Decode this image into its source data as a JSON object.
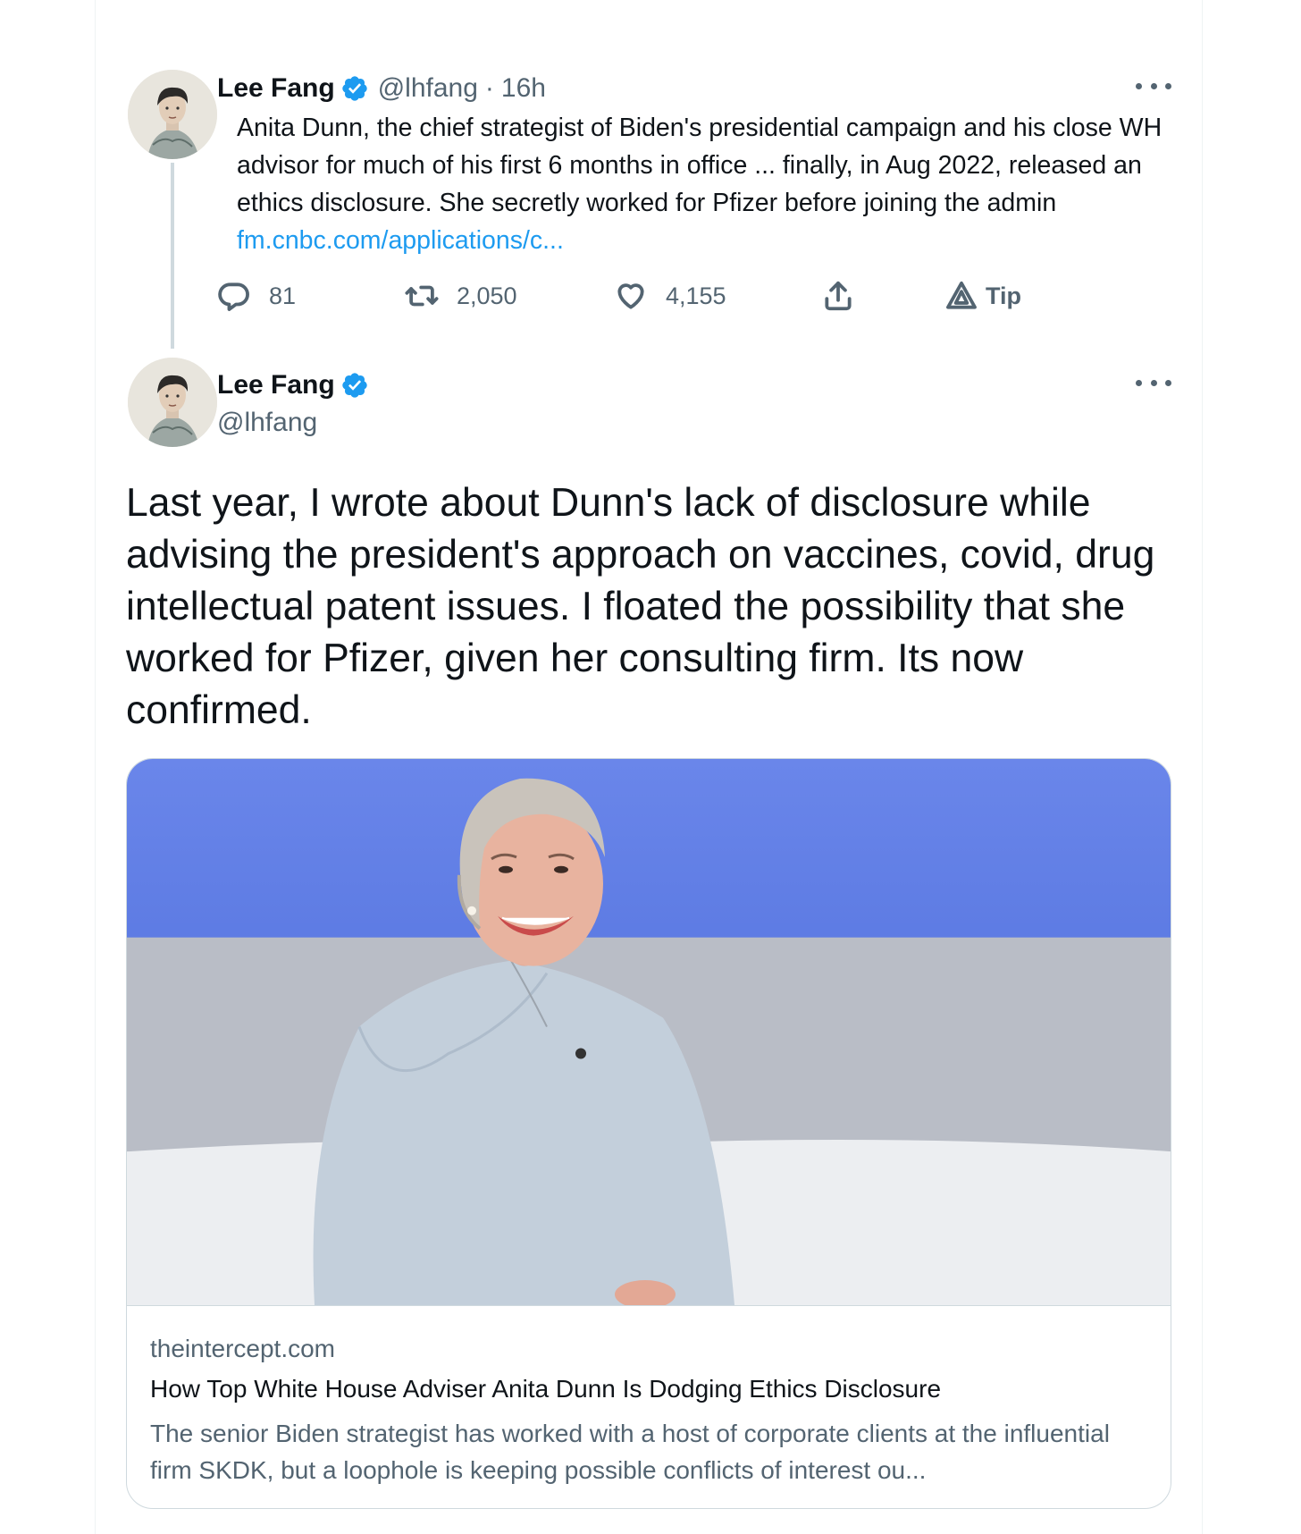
{
  "parent_tweet": {
    "author_name": "Lee Fang",
    "handle": "@lhfang",
    "separator": "·",
    "time": "16h",
    "text": "Anita Dunn, the chief strategist of Biden's presidential campaign and his close WH advisor for much of his first 6 months in office ... finally, in Aug 2022, released an ethics disclosure. She secretly worked for Pfizer before joining the admin ",
    "link_text": "fm.cnbc.com/applications/c...",
    "actions": {
      "replies": "81",
      "retweets": "2,050",
      "likes": "4,155",
      "tip_label": "Tip"
    }
  },
  "main_tweet": {
    "author_name": "Lee Fang",
    "handle": "@lhfang",
    "text": "Last year, I wrote about Dunn's lack of disclosure while advising the president's approach on vaccines, covid, drug intellectual patent issues. I floated the possibility that she worked for Pfizer, given her consulting firm. Its now confirmed.",
    "card": {
      "domain": "theintercept.com",
      "title": "How Top White House Adviser Anita Dunn Is Dodging Ethics Disclosure",
      "description": "The senior Biden strategist has worked with a host of corporate clients at the influential firm SKDK, but a loophole is keeping possible conflicts of interest ou..."
    }
  },
  "icons": [
    "verified-badge-icon",
    "more-icon",
    "reply-icon",
    "retweet-icon",
    "like-icon",
    "share-icon",
    "tip-icon"
  ],
  "colors": {
    "accent": "#1d9bf0",
    "muted": "#536471",
    "text": "#0f1419",
    "border": "#cfd9de"
  }
}
